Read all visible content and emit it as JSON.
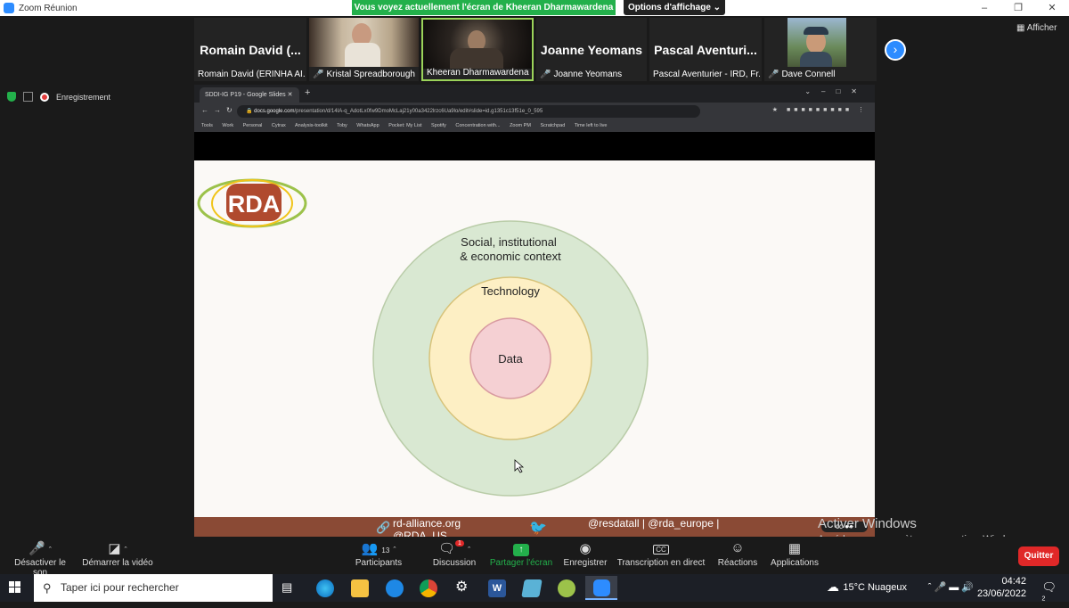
{
  "window": {
    "title": "Zoom Réunion"
  },
  "banner": {
    "share_text": "Vous voyez actuellement l'écran de Kheeran Dharmawardena",
    "view_options": "Options d'affichage"
  },
  "gallery": {
    "tiles": [
      {
        "big_name": "Romain David (...",
        "label": "Romain David (ERINHA AI..."
      },
      {
        "big_name": "",
        "label": "Kristal Spreadborough"
      },
      {
        "big_name": "",
        "label": "Kheeran Dharmawardena"
      },
      {
        "big_name": "Joanne Yeomans",
        "label": "Joanne Yeomans"
      },
      {
        "big_name": "Pascal Aventuri...",
        "label": "Pascal Aventurier - IRD, Fr..."
      },
      {
        "big_name": "",
        "label": "Dave Connell"
      }
    ],
    "afficher": "Afficher"
  },
  "recording": {
    "label": "Enregistrement"
  },
  "browser": {
    "tab_title": "SDDI-IG P19 - Google Slides",
    "url_domain": "docs.google.com",
    "url_path": "/presentation/d/14IA-q_AdotLx0fw9DmoMcLaj21y00a3422lrzc6Ua9lo/edit#slide=id.g1351c13f51e_0_595",
    "bookmarks": [
      "Tools",
      "Work",
      "Personal",
      "Cytrax",
      "Analysis-toolkit",
      "Toby",
      "WhatsApp",
      "Pocket: My List",
      "Spotify",
      "Concentration with...",
      "Zoom PM",
      "Scratchpad",
      "Time left to live"
    ]
  },
  "slide": {
    "logo": "RDA",
    "outer_label_1": "Social, institutional",
    "outer_label_2": "& economic context",
    "middle_label": "Technology",
    "inner_label": "Data",
    "colors": {
      "outer": "#d9e8d2",
      "middle": "#fdefc4",
      "inner": "#f5d0d3"
    }
  },
  "footer": {
    "link_1": "rd-alliance.org",
    "link_2": "@RDA_US",
    "handles": "@resdatall | @rda_europe |"
  },
  "watermark": {
    "line1": "Activer Windows",
    "line2": "Accédez aux paramètres pour activer Windows."
  },
  "controls": {
    "mute": "Désactiver le son",
    "video": "Démarrer la vidéo",
    "participants": "Participants",
    "participants_count": "13",
    "chat": "Discussion",
    "chat_badge": "1",
    "share": "Partager l'écran",
    "record": "Enregistrer",
    "transcription": "Transcription en direct",
    "reactions": "Réactions",
    "apps": "Applications",
    "quit": "Quitter"
  },
  "taskbar": {
    "search_placeholder": "Taper ici pour rechercher",
    "weather": "15°C  Nuageux",
    "time": "04:42",
    "date": "23/06/2022",
    "notifications": "2"
  }
}
